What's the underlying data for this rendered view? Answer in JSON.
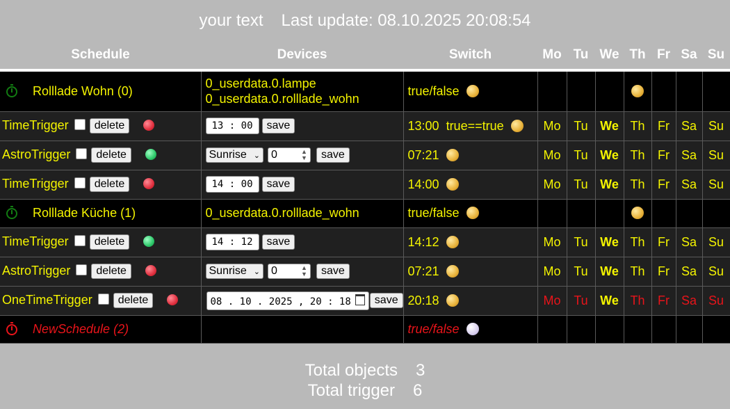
{
  "header": {
    "title": "your text",
    "last_update": "Last update: 08.10.2025 20:08:54"
  },
  "columns": [
    "Schedule",
    "Devices",
    "Switch",
    "Mo",
    "Tu",
    "We",
    "Th",
    "Fr",
    "Sa",
    "Su"
  ],
  "rows": [
    {
      "schedule": "Rolllade Wohn  (0)",
      "devices": [
        "0_userdata.0.lampe",
        "0_userdata.0.rolllade_wohn"
      ],
      "switch": "true/false"
    },
    {
      "trigger": "TimeTrigger",
      "delete": "delete",
      "time": "13 : 00",
      "save": "save",
      "switch": "13:00",
      "condition": "true==true",
      "days": [
        "Mo",
        "Tu",
        "We",
        "Th",
        "Fr",
        "Sa",
        "Su"
      ]
    },
    {
      "trigger": "AstroTrigger",
      "delete": "delete",
      "astro": "Sunrise",
      "offset": "0",
      "save": "save",
      "switch": "07:21",
      "days": [
        "Mo",
        "Tu",
        "We",
        "Th",
        "Fr",
        "Sa",
        "Su"
      ]
    },
    {
      "trigger": "TimeTrigger",
      "delete": "delete",
      "time": "14 : 00",
      "save": "save",
      "switch": "14:00",
      "days": [
        "Mo",
        "Tu",
        "We",
        "Th",
        "Fr",
        "Sa",
        "Su"
      ]
    },
    {
      "schedule": "Rolllade Küche  (1)",
      "devices": [
        "0_userdata.0.rolllade_wohn"
      ],
      "switch": "true/false"
    },
    {
      "trigger": "TimeTrigger",
      "delete": "delete",
      "time": "14 : 12",
      "save": "save",
      "switch": "14:12",
      "days": [
        "Mo",
        "Tu",
        "We",
        "Th",
        "Fr",
        "Sa",
        "Su"
      ]
    },
    {
      "trigger": "AstroTrigger",
      "delete": "delete",
      "astro": "Sunrise",
      "offset": "0",
      "save": "save",
      "switch": "07:21",
      "days": [
        "Mo",
        "Tu",
        "We",
        "Th",
        "Fr",
        "Sa",
        "Su"
      ]
    },
    {
      "trigger": "OneTimeTrigger",
      "delete": "delete",
      "datetime": "08 . 10 . 2025 ,  20 : 18",
      "save": "save",
      "switch": "20:18",
      "days": [
        "Mo",
        "Tu",
        "We",
        "Th",
        "Fr",
        "Sa",
        "Su"
      ]
    },
    {
      "schedule": "NewSchedule  (2)",
      "switch": "true/false"
    }
  ],
  "footer": {
    "total_objects_label": "Total objects",
    "total_objects_value": "3",
    "total_trigger_label": "Total trigger",
    "total_trigger_value": "6"
  },
  "colors": {
    "text_yellow": "#f4f400",
    "alert_red": "#e8141a",
    "header_gray": "#b9b9b9",
    "row_dark": "#202020"
  },
  "icons": [
    "stopwatch-icon",
    "status-lamp-icon",
    "status-dot-icon",
    "calendar-icon"
  ]
}
